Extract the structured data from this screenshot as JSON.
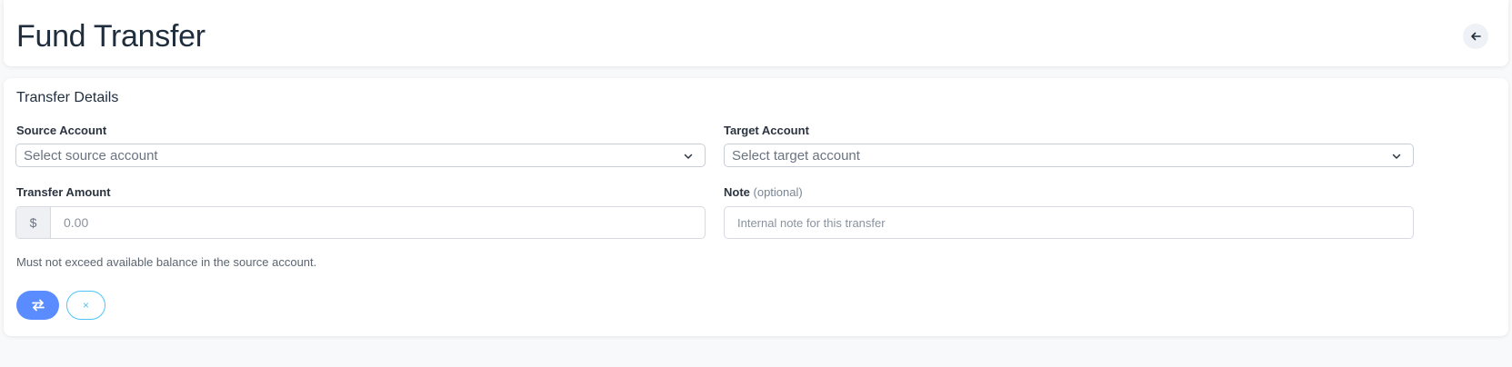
{
  "page": {
    "title": "Fund Transfer"
  },
  "header": {
    "back_icon": "arrow-left-icon"
  },
  "form": {
    "section_title": "Transfer Details",
    "source_account": {
      "label": "Source Account",
      "placeholder": "Select source account"
    },
    "target_account": {
      "label": "Target Account",
      "placeholder": "Select target account"
    },
    "amount": {
      "label": "Transfer Amount",
      "prefix": "$",
      "placeholder": "0.00",
      "help": "Must not exceed available balance in the source account."
    },
    "note": {
      "label": "Note",
      "optional_label": "(optional)",
      "placeholder": "Internal note for this transfer"
    },
    "actions": {
      "submit_icon": "transfer-arrows-icon",
      "cancel_glyph": "×"
    }
  },
  "colors": {
    "primary": "#5b8cff",
    "info_outline": "#4fc3f7"
  }
}
